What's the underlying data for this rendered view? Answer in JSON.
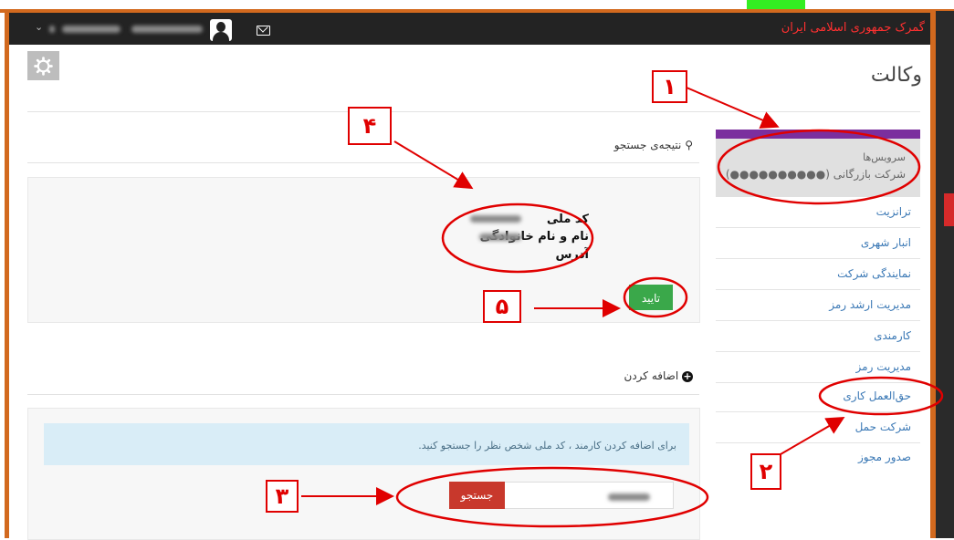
{
  "app": {
    "brand": "گمرک جمهوری اسلامی ایران"
  },
  "header": {
    "user_name_blurred": "",
    "user_id_blurred": ""
  },
  "page": {
    "title": "وکالت"
  },
  "sidebar": {
    "header_label": "سرویس‌ها",
    "company": "شرکت بازرگانی (●●●●●●●●●●)",
    "items": [
      {
        "label": "ترانزیت"
      },
      {
        "label": "انبار شهری"
      },
      {
        "label": "نمایندگی شرکت"
      },
      {
        "label": "مدیریت ارشد رمز"
      },
      {
        "label": "کارمندی"
      },
      {
        "label": "مدیریت رمز"
      },
      {
        "label": "حق‌العمل کاری"
      },
      {
        "label": "شرکت حمل"
      },
      {
        "label": "صدور مجوز"
      }
    ]
  },
  "search_result": {
    "title": "نتیجه‌ی جستجو",
    "national_code_label": "کد ملی",
    "name_label": "نام و نام خانوادگی",
    "address_label": "آدرس",
    "confirm_label": "تایید"
  },
  "add": {
    "title": "اضافه کردن",
    "info": "برای اضافه کردن کارمند ، کد ملی شخص نظر را جستجو کنید.",
    "search_button": "جستجو",
    "search_value": ""
  },
  "annotations": {
    "c1": "۱",
    "c2": "۲",
    "c3": "۳",
    "c4": "۴",
    "c5": "۵"
  },
  "colors": {
    "accent_red": "#e00000",
    "orange_frame": "#d2691e",
    "purple": "#7b2f9e",
    "green": "#3aa84a"
  }
}
